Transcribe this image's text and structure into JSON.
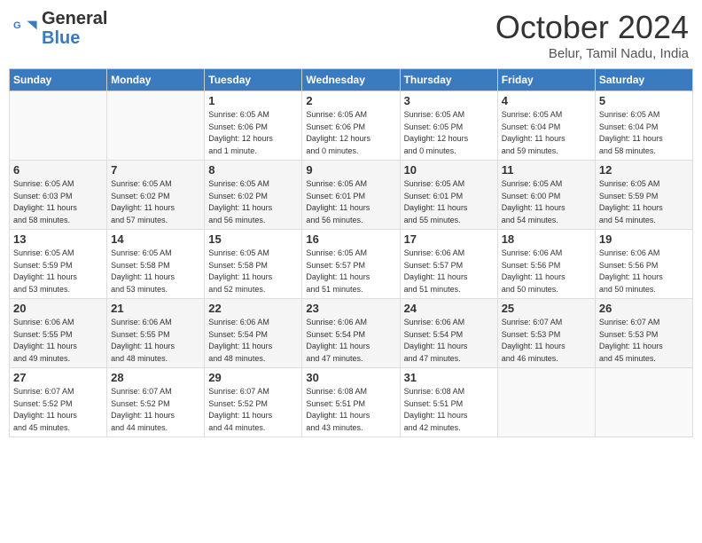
{
  "header": {
    "logo_line1": "General",
    "logo_line2": "Blue",
    "month_title": "October 2024",
    "subtitle": "Belur, Tamil Nadu, India"
  },
  "weekdays": [
    "Sunday",
    "Monday",
    "Tuesday",
    "Wednesday",
    "Thursday",
    "Friday",
    "Saturday"
  ],
  "weeks": [
    [
      {
        "day": "",
        "info": ""
      },
      {
        "day": "",
        "info": ""
      },
      {
        "day": "1",
        "info": "Sunrise: 6:05 AM\nSunset: 6:06 PM\nDaylight: 12 hours\nand 1 minute."
      },
      {
        "day": "2",
        "info": "Sunrise: 6:05 AM\nSunset: 6:06 PM\nDaylight: 12 hours\nand 0 minutes."
      },
      {
        "day": "3",
        "info": "Sunrise: 6:05 AM\nSunset: 6:05 PM\nDaylight: 12 hours\nand 0 minutes."
      },
      {
        "day": "4",
        "info": "Sunrise: 6:05 AM\nSunset: 6:04 PM\nDaylight: 11 hours\nand 59 minutes."
      },
      {
        "day": "5",
        "info": "Sunrise: 6:05 AM\nSunset: 6:04 PM\nDaylight: 11 hours\nand 58 minutes."
      }
    ],
    [
      {
        "day": "6",
        "info": "Sunrise: 6:05 AM\nSunset: 6:03 PM\nDaylight: 11 hours\nand 58 minutes."
      },
      {
        "day": "7",
        "info": "Sunrise: 6:05 AM\nSunset: 6:02 PM\nDaylight: 11 hours\nand 57 minutes."
      },
      {
        "day": "8",
        "info": "Sunrise: 6:05 AM\nSunset: 6:02 PM\nDaylight: 11 hours\nand 56 minutes."
      },
      {
        "day": "9",
        "info": "Sunrise: 6:05 AM\nSunset: 6:01 PM\nDaylight: 11 hours\nand 56 minutes."
      },
      {
        "day": "10",
        "info": "Sunrise: 6:05 AM\nSunset: 6:01 PM\nDaylight: 11 hours\nand 55 minutes."
      },
      {
        "day": "11",
        "info": "Sunrise: 6:05 AM\nSunset: 6:00 PM\nDaylight: 11 hours\nand 54 minutes."
      },
      {
        "day": "12",
        "info": "Sunrise: 6:05 AM\nSunset: 5:59 PM\nDaylight: 11 hours\nand 54 minutes."
      }
    ],
    [
      {
        "day": "13",
        "info": "Sunrise: 6:05 AM\nSunset: 5:59 PM\nDaylight: 11 hours\nand 53 minutes."
      },
      {
        "day": "14",
        "info": "Sunrise: 6:05 AM\nSunset: 5:58 PM\nDaylight: 11 hours\nand 53 minutes."
      },
      {
        "day": "15",
        "info": "Sunrise: 6:05 AM\nSunset: 5:58 PM\nDaylight: 11 hours\nand 52 minutes."
      },
      {
        "day": "16",
        "info": "Sunrise: 6:05 AM\nSunset: 5:57 PM\nDaylight: 11 hours\nand 51 minutes."
      },
      {
        "day": "17",
        "info": "Sunrise: 6:06 AM\nSunset: 5:57 PM\nDaylight: 11 hours\nand 51 minutes."
      },
      {
        "day": "18",
        "info": "Sunrise: 6:06 AM\nSunset: 5:56 PM\nDaylight: 11 hours\nand 50 minutes."
      },
      {
        "day": "19",
        "info": "Sunrise: 6:06 AM\nSunset: 5:56 PM\nDaylight: 11 hours\nand 50 minutes."
      }
    ],
    [
      {
        "day": "20",
        "info": "Sunrise: 6:06 AM\nSunset: 5:55 PM\nDaylight: 11 hours\nand 49 minutes."
      },
      {
        "day": "21",
        "info": "Sunrise: 6:06 AM\nSunset: 5:55 PM\nDaylight: 11 hours\nand 48 minutes."
      },
      {
        "day": "22",
        "info": "Sunrise: 6:06 AM\nSunset: 5:54 PM\nDaylight: 11 hours\nand 48 minutes."
      },
      {
        "day": "23",
        "info": "Sunrise: 6:06 AM\nSunset: 5:54 PM\nDaylight: 11 hours\nand 47 minutes."
      },
      {
        "day": "24",
        "info": "Sunrise: 6:06 AM\nSunset: 5:54 PM\nDaylight: 11 hours\nand 47 minutes."
      },
      {
        "day": "25",
        "info": "Sunrise: 6:07 AM\nSunset: 5:53 PM\nDaylight: 11 hours\nand 46 minutes."
      },
      {
        "day": "26",
        "info": "Sunrise: 6:07 AM\nSunset: 5:53 PM\nDaylight: 11 hours\nand 45 minutes."
      }
    ],
    [
      {
        "day": "27",
        "info": "Sunrise: 6:07 AM\nSunset: 5:52 PM\nDaylight: 11 hours\nand 45 minutes."
      },
      {
        "day": "28",
        "info": "Sunrise: 6:07 AM\nSunset: 5:52 PM\nDaylight: 11 hours\nand 44 minutes."
      },
      {
        "day": "29",
        "info": "Sunrise: 6:07 AM\nSunset: 5:52 PM\nDaylight: 11 hours\nand 44 minutes."
      },
      {
        "day": "30",
        "info": "Sunrise: 6:08 AM\nSunset: 5:51 PM\nDaylight: 11 hours\nand 43 minutes."
      },
      {
        "day": "31",
        "info": "Sunrise: 6:08 AM\nSunset: 5:51 PM\nDaylight: 11 hours\nand 42 minutes."
      },
      {
        "day": "",
        "info": ""
      },
      {
        "day": "",
        "info": ""
      }
    ]
  ]
}
